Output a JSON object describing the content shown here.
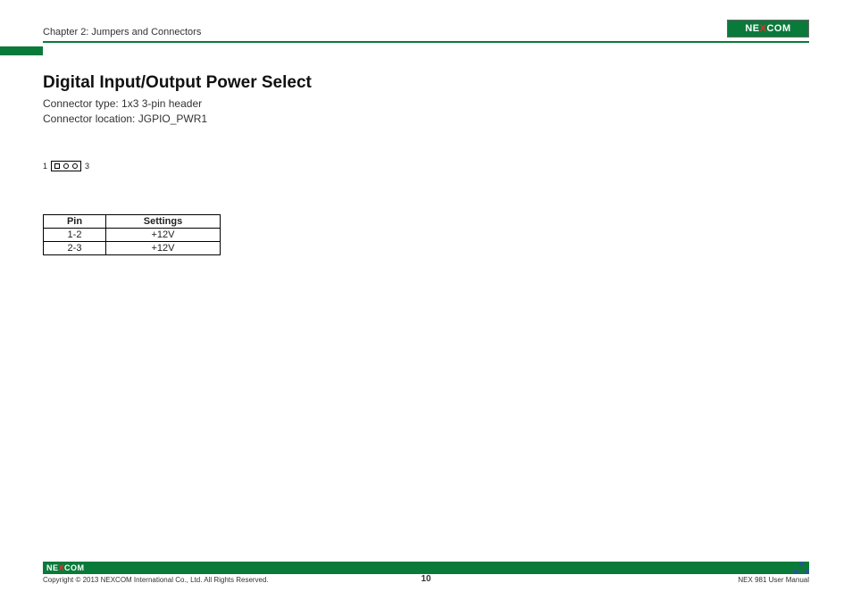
{
  "header": {
    "chapter": "Chapter 2: Jumpers and Connectors",
    "logo_text_pre": "NE",
    "logo_text_x": "X",
    "logo_text_post": "COM"
  },
  "section": {
    "title": "Digital Input/Output Power Select",
    "connector_type": "Connector type: 1x3 3-pin header",
    "connector_location": "Connector location: JGPIO_PWR1"
  },
  "diagram": {
    "left_label": "1",
    "right_label": "3"
  },
  "table": {
    "headers": {
      "pin": "Pin",
      "settings": "Settings"
    },
    "rows": [
      {
        "pin": "1-2",
        "settings": "+12V"
      },
      {
        "pin": "2-3",
        "settings": "+12V"
      }
    ]
  },
  "footer": {
    "copyright": "Copyright © 2013 NEXCOM International Co., Ltd. All Rights Reserved.",
    "page_number": "10",
    "manual": "NEX 981 User Manual"
  }
}
